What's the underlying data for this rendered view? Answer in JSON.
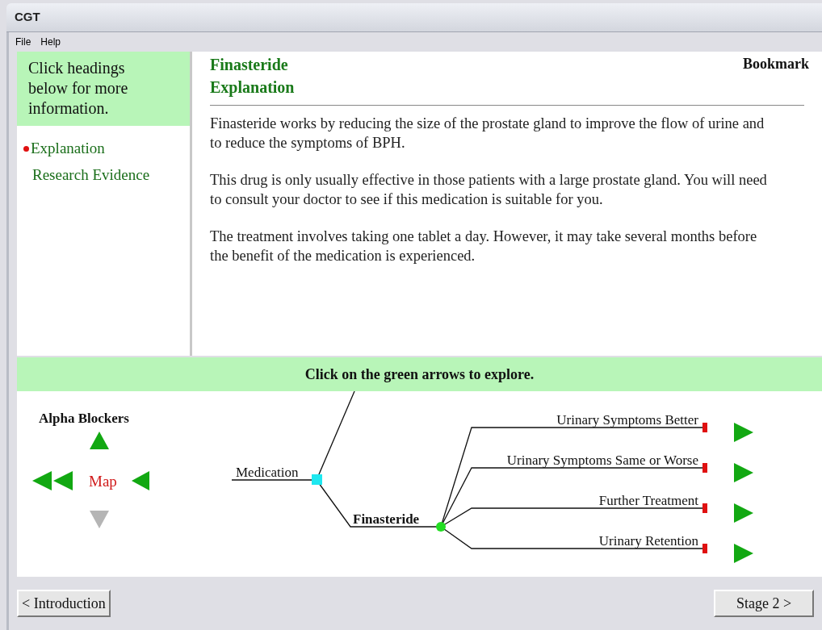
{
  "window": {
    "title": "CGT"
  },
  "menu": [
    "File",
    "Help"
  ],
  "sidebar": {
    "header": "Click headings below for more information.",
    "items": [
      {
        "label": "Explanation",
        "selected": true
      },
      {
        "label": "Research Evidence",
        "selected": false
      }
    ]
  },
  "content": {
    "title": "Finasteride",
    "subtitle": "Explanation",
    "bookmark": "Bookmark",
    "paragraphs": [
      "Finasteride works by reducing the size of the prostate gland to improve the flow of urine and to reduce the symptoms of BPH.",
      "This drug is only usually effective in those patients with a large prostate gland. You will need to consult your doctor to see if this medication is suitable for you.",
      "The treatment involves taking one tablet a day. However, it may take several months before the benefit of the medication is experienced."
    ]
  },
  "map": {
    "hint": "Click on the green arrows to explore.",
    "nav": {
      "up_label": "Alpha Blockers",
      "center_label": "Map",
      "up_enabled": true,
      "down_enabled": false
    },
    "root": "Medication",
    "node": "Finasteride",
    "outcomes": [
      "Urinary Symptoms Better",
      "Urinary Symptoms Same or Worse",
      "Further Treatment",
      "Urinary Retention"
    ]
  },
  "footer": {
    "back": "< Introduction",
    "next": "Stage 2 >"
  }
}
